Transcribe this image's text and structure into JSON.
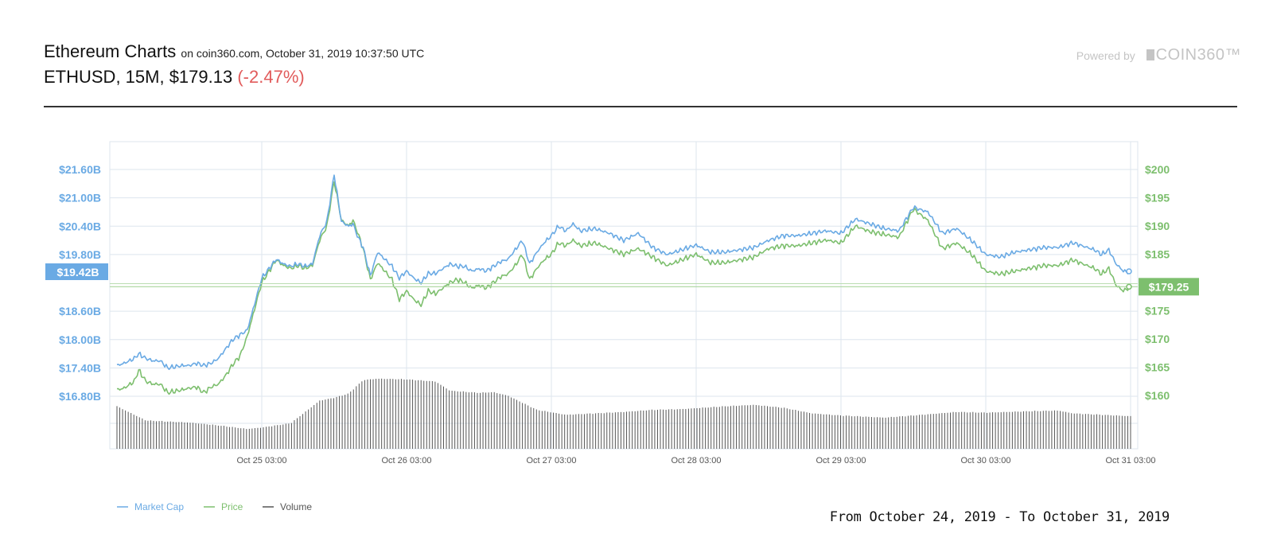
{
  "header": {
    "title": "Ethereum Charts",
    "subtitle": "on coin360.com, October 31, 2019 10:37:50 UTC",
    "pair_info": "ETHUSD, 15M, $179.13",
    "change": "(-2.47%)"
  },
  "branding": {
    "powered_label": "Powered by",
    "brand_name": "COIN360™"
  },
  "range_text": "From October 24, 2019 - To October 31, 2019",
  "colors": {
    "market_cap": "#6aaae4",
    "price": "#7dbf6e",
    "volume": "#555555",
    "change_negative": "#e15b5b",
    "grid": "#dde5ee"
  },
  "chart_data": {
    "type": "line",
    "title": "Ethereum Charts",
    "x_ticks": [
      "Oct 25 03:00",
      "Oct 26 03:00",
      "Oct 27 03:00",
      "Oct 28 03:00",
      "Oct 29 03:00",
      "Oct 30 03:00",
      "Oct 31 03:00"
    ],
    "x_tick_days": [
      0.5,
      1.5,
      2.5,
      3.5,
      4.5,
      5.5,
      6.5
    ],
    "xlim_days": [
      -0.5,
      6.5
    ],
    "left_axis": {
      "ticks": [
        "$21.60B",
        "$21.00B",
        "$20.40B",
        "$19.80B",
        "$18.60B",
        "$18.00B",
        "$17.40B",
        "$16.80B"
      ],
      "values": [
        21.6,
        21.0,
        20.4,
        19.8,
        18.6,
        18.0,
        17.4,
        16.8
      ],
      "unit": "B USD"
    },
    "right_axis": {
      "ticks": [
        "$200",
        "$195",
        "$190",
        "$185",
        "$175",
        "$170",
        "$165",
        "$160"
      ],
      "values": [
        200,
        195,
        190,
        185,
        175,
        170,
        165,
        160
      ]
    },
    "current_market_cap_label": "$19.42B",
    "current_market_cap": 19.42,
    "current_price_label": "$179.25",
    "current_price": 179.25,
    "legend": [
      "Market Cap",
      "Price",
      "Volume"
    ],
    "legend_position": "bottom-left",
    "grid": true,
    "series": [
      {
        "name": "Price",
        "axis": "right",
        "x": [
          0,
          0.05,
          0.12,
          0.15,
          0.2,
          0.25,
          0.3,
          0.35,
          0.45,
          0.5,
          0.55,
          0.6,
          0.65,
          0.7,
          0.75,
          0.8,
          0.85,
          0.9,
          1.0,
          1.1,
          1.15,
          1.2,
          1.25,
          1.3,
          1.35,
          1.4,
          1.45,
          1.5,
          1.55,
          1.6,
          1.63,
          1.66,
          1.7,
          1.75,
          1.8,
          1.85,
          1.9,
          1.95,
          2.0,
          2.05,
          2.1,
          2.15,
          2.2,
          2.25,
          2.3,
          2.35,
          2.4,
          2.45,
          2.5,
          2.55,
          2.6,
          2.65,
          2.7,
          2.75,
          2.8,
          2.85,
          2.9,
          2.95,
          3.0,
          3.05,
          3.1,
          3.15,
          3.2,
          3.3,
          3.4,
          3.5,
          3.6,
          3.7,
          3.8,
          3.9,
          4.0,
          4.1,
          4.2,
          4.3,
          4.4,
          4.5,
          4.6,
          4.7,
          4.8,
          4.9,
          5.0,
          5.1,
          5.2,
          5.3,
          5.4,
          5.5,
          5.6,
          5.7,
          5.8,
          5.9,
          6.0,
          6.1,
          6.2,
          6.3,
          6.4,
          6.5,
          6.6,
          6.7,
          6.75,
          6.8,
          6.85,
          6.9,
          6.95,
          7.0
        ],
        "values": [
          161,
          161.3,
          162.5,
          164.5,
          162.5,
          162,
          162,
          160.5,
          161,
          161.3,
          161.5,
          160.5,
          161.5,
          162,
          163.5,
          165.5,
          167,
          170.5,
          180,
          184,
          183,
          182.5,
          183,
          182.5,
          183,
          187.5,
          190,
          198,
          191,
          190,
          191,
          189,
          186,
          180.5,
          183.5,
          182,
          180.5,
          177,
          178.5,
          177,
          176,
          178.5,
          178,
          179,
          180,
          180.5,
          180,
          179,
          179.5,
          179,
          180,
          181,
          181.5,
          183,
          185,
          180.5,
          182.5,
          184,
          185,
          187,
          186.5,
          187.5,
          186.5,
          187,
          186,
          185,
          186,
          184.5,
          183,
          184,
          185,
          183.5,
          183.5,
          184,
          184.5,
          186,
          186.5,
          186.5,
          187,
          187.5,
          187,
          190,
          189,
          188.5,
          188,
          193,
          191,
          186,
          187,
          185,
          182,
          181.5,
          182,
          182.5,
          183,
          183,
          184,
          183,
          182.5,
          181.5,
          182.5,
          179.5,
          178.5,
          179.25
        ]
      },
      {
        "name": "Market Cap",
        "axis": "left",
        "x": [
          0,
          0.05,
          0.12,
          0.15,
          0.2,
          0.25,
          0.3,
          0.35,
          0.45,
          0.5,
          0.55,
          0.6,
          0.65,
          0.7,
          0.75,
          0.8,
          0.85,
          0.9,
          1.0,
          1.1,
          1.15,
          1.2,
          1.25,
          1.3,
          1.35,
          1.4,
          1.45,
          1.5,
          1.55,
          1.6,
          1.63,
          1.66,
          1.7,
          1.75,
          1.8,
          1.85,
          1.9,
          1.95,
          2.0,
          2.05,
          2.1,
          2.15,
          2.2,
          2.25,
          2.3,
          2.35,
          2.4,
          2.45,
          2.5,
          2.55,
          2.6,
          2.65,
          2.7,
          2.75,
          2.8,
          2.85,
          2.9,
          2.95,
          3.0,
          3.05,
          3.1,
          3.15,
          3.2,
          3.3,
          3.4,
          3.5,
          3.6,
          3.7,
          3.8,
          3.9,
          4.0,
          4.1,
          4.2,
          4.3,
          4.4,
          4.5,
          4.6,
          4.7,
          4.8,
          4.9,
          5.0,
          5.1,
          5.2,
          5.3,
          5.4,
          5.5,
          5.6,
          5.7,
          5.8,
          5.9,
          6.0,
          6.1,
          6.2,
          6.3,
          6.4,
          6.5,
          6.6,
          6.7,
          6.75,
          6.8,
          6.85,
          6.9,
          6.95,
          7.0
        ],
        "values": [
          17.45,
          17.5,
          17.6,
          17.7,
          17.6,
          17.55,
          17.55,
          17.4,
          17.45,
          17.45,
          17.5,
          17.45,
          17.5,
          17.6,
          17.8,
          18.0,
          18.1,
          18.2,
          19.3,
          19.7,
          19.6,
          19.55,
          19.6,
          19.55,
          19.6,
          20.2,
          20.5,
          21.5,
          20.5,
          20.4,
          20.45,
          20.2,
          19.95,
          19.35,
          19.85,
          19.7,
          19.55,
          19.3,
          19.45,
          19.3,
          19.2,
          19.4,
          19.4,
          19.5,
          19.6,
          19.55,
          19.55,
          19.45,
          19.5,
          19.45,
          19.55,
          19.65,
          19.7,
          19.9,
          20.1,
          19.6,
          19.85,
          20.05,
          20.2,
          20.4,
          20.3,
          20.45,
          20.3,
          20.35,
          20.25,
          20.1,
          20.25,
          19.95,
          19.8,
          19.9,
          20.0,
          19.85,
          19.85,
          19.9,
          19.95,
          20.1,
          20.2,
          20.2,
          20.25,
          20.3,
          20.25,
          20.55,
          20.45,
          20.35,
          20.3,
          20.8,
          20.7,
          20.25,
          20.35,
          20.1,
          19.8,
          19.75,
          19.85,
          19.9,
          19.95,
          19.95,
          20.05,
          19.95,
          19.9,
          19.8,
          19.9,
          19.6,
          19.45,
          19.42
        ]
      },
      {
        "name": "Volume",
        "axis": "volume",
        "x": [
          0,
          0.2,
          0.5,
          0.6,
          0.7,
          0.9,
          1.0,
          1.2,
          1.4,
          1.5,
          1.6,
          1.7,
          1.8,
          2.0,
          2.2,
          2.3,
          2.5,
          2.6,
          2.7,
          2.9,
          3.1,
          3.3,
          3.5,
          3.7,
          3.9,
          4.2,
          4.4,
          4.6,
          4.8,
          5.0,
          5.3,
          5.5,
          5.8,
          6.0,
          6.3,
          6.5,
          6.6,
          6.8,
          7.0
        ],
        "values": [
          0.6,
          0.4,
          0.37,
          0.35,
          0.33,
          0.28,
          0.3,
          0.36,
          0.68,
          0.72,
          0.78,
          0.97,
          0.99,
          0.98,
          0.95,
          0.82,
          0.79,
          0.8,
          0.75,
          0.55,
          0.48,
          0.5,
          0.52,
          0.55,
          0.56,
          0.6,
          0.62,
          0.58,
          0.5,
          0.47,
          0.44,
          0.47,
          0.52,
          0.51,
          0.53,
          0.54,
          0.5,
          0.48,
          0.46
        ]
      }
    ]
  }
}
